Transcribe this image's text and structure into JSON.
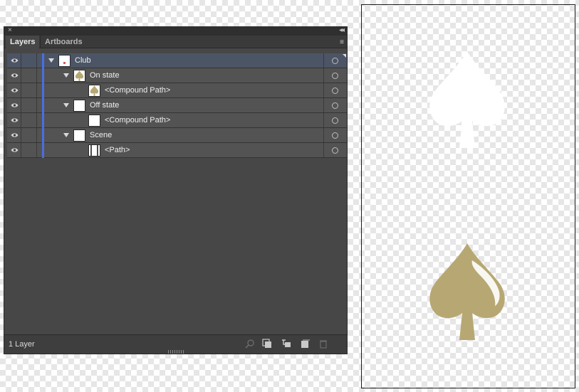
{
  "panel": {
    "close_glyph": "×",
    "collapse_glyph": "◂◂",
    "tabs": [
      "Layers",
      "Artboards"
    ],
    "menu_glyph": "≡"
  },
  "layers": [
    {
      "label": "Club",
      "depth": 0,
      "expanded": true,
      "selected": true,
      "thumb": "club-thumb"
    },
    {
      "label": "On state",
      "depth": 1,
      "expanded": true,
      "selected": false,
      "thumb": "spade-thumb"
    },
    {
      "label": "<Compound Path>",
      "depth": 2,
      "expanded": false,
      "selected": false,
      "thumb": "spade-thumb"
    },
    {
      "label": "Off state",
      "depth": 1,
      "expanded": true,
      "selected": false,
      "thumb": "blank-thumb"
    },
    {
      "label": "<Compound Path>",
      "depth": 2,
      "expanded": false,
      "selected": false,
      "thumb": "blank-thumb"
    },
    {
      "label": "Scene",
      "depth": 1,
      "expanded": true,
      "selected": false,
      "thumb": "blank-thumb"
    },
    {
      "label": "<Path>",
      "depth": 2,
      "expanded": false,
      "selected": false,
      "thumb": "path-thumb"
    }
  ],
  "footer": {
    "layer_count": "1 Layer",
    "icons": [
      "locate-object-icon",
      "make-clipping-mask-icon",
      "create-sublayer-icon",
      "new-layer-icon",
      "delete-icon"
    ]
  },
  "colors": {
    "layer_color": "#4a6ee0",
    "spade_gold": "#b7a873",
    "spade_white": "#ffffff"
  }
}
